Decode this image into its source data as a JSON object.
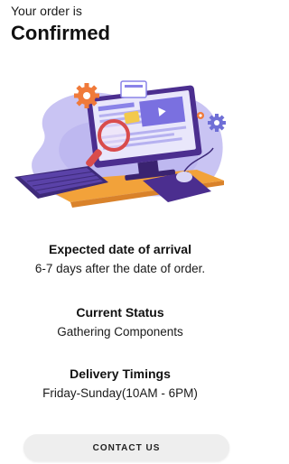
{
  "header": {
    "subtitle": "Your order is",
    "title": "Confirmed"
  },
  "illustration": {
    "icon": "computer-workspace-illustration",
    "colors": {
      "blob": "#c9c4f3",
      "monitor": "#4b2e8f",
      "keyboard": "#3e2a7a",
      "desk": "#f2a23a",
      "magnifier": "#d94c4c",
      "gear_orange": "#f07a3a",
      "gear_blue": "#6f6fd6"
    }
  },
  "details": [
    {
      "label": "Expected date of arrival",
      "value": "6-7 days after the date of order."
    },
    {
      "label": "Current Status",
      "value": "Gathering Components"
    },
    {
      "label": "Delivery Timings",
      "value": "Friday-Sunday(10AM - 6PM)"
    }
  ],
  "actions": {
    "contact_label": "CONTACT US"
  }
}
